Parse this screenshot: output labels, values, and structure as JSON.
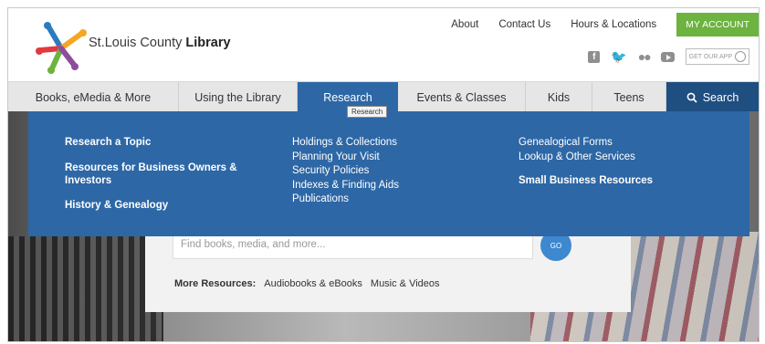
{
  "brand": {
    "name_light": "St.Louis County",
    "name_bold": "Library"
  },
  "toplinks": [
    "About",
    "Contact Us",
    "Hours & Locations"
  ],
  "my_account": "MY ACCOUNT",
  "social": {
    "facebook": "f",
    "app_label": "GET OUR APP"
  },
  "nav": {
    "items": [
      "Books, eMedia & More",
      "Using the Library",
      "Research",
      "Events & Classes",
      "Kids",
      "Teens"
    ],
    "search": "Search",
    "tooltip": "Research"
  },
  "mega": {
    "col1": [
      "Research a Topic",
      "Resources for Business Owners & Investors",
      "History & Genealogy"
    ],
    "col2": [
      "Holdings & Collections",
      "Planning Your Visit",
      "Security Policies",
      "Indexes & Finding Aids",
      "Publications"
    ],
    "col3": [
      "Genealogical Forms",
      "Lookup & Other Services",
      "Small Business Resources"
    ]
  },
  "search_box": {
    "placeholder": "Find books, media, and more...",
    "go": "GO"
  },
  "more": {
    "label": "More Resources:",
    "links": [
      "Audiobooks & eBooks",
      "Music & Videos"
    ]
  },
  "colors": {
    "nav_active": "#2d67a6",
    "nav_search": "#1f4e81",
    "my_account": "#6cb33f",
    "go_button": "#3e88cf"
  }
}
